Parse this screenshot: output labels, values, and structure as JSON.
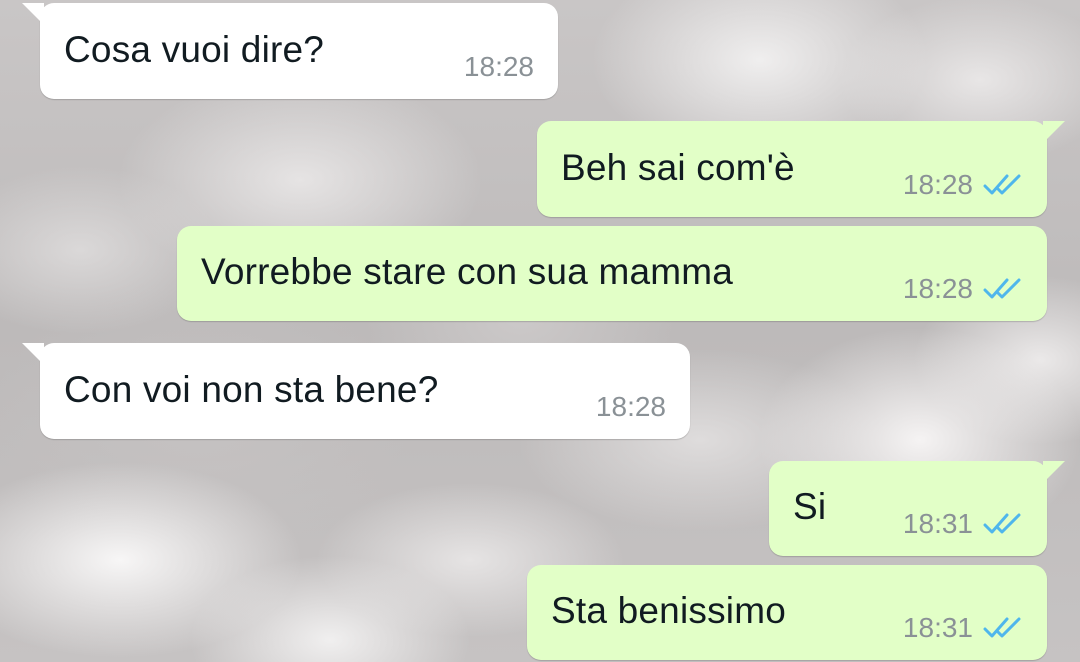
{
  "chat": {
    "messages": [
      {
        "direction": "incoming",
        "text": "Cosa vuoi dire?",
        "time": "18:28",
        "read": false
      },
      {
        "direction": "outgoing",
        "text": "Beh sai com'è",
        "time": "18:28",
        "read": true
      },
      {
        "direction": "outgoing",
        "text": "Vorrebbe stare con sua mamma",
        "time": "18:28",
        "read": true
      },
      {
        "direction": "incoming",
        "text": "Con voi non sta bene?",
        "time": "18:28",
        "read": false
      },
      {
        "direction": "outgoing",
        "text": "Si",
        "time": "18:31",
        "read": true
      },
      {
        "direction": "outgoing",
        "text": "Sta benissimo",
        "time": "18:31",
        "read": true
      }
    ]
  },
  "colors": {
    "incoming_bubble": "#ffffff",
    "outgoing_bubble": "#e2ffc7",
    "read_ticks": "#4fb6ec",
    "time_text": "#8a9196"
  },
  "icons": {
    "read_receipt": "double-check-icon"
  }
}
